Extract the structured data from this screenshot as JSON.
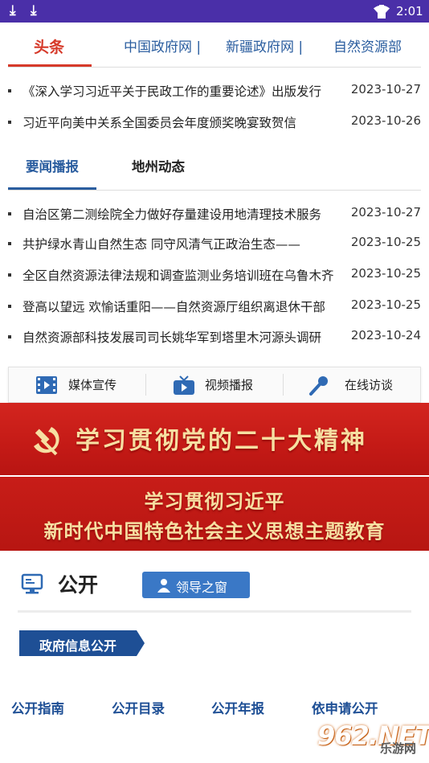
{
  "status_bar": {
    "time": "2:01",
    "download_glyph": "⤓"
  },
  "top_tabs": [
    {
      "label": "头条",
      "active": true
    },
    {
      "label": "中国政府网 |",
      "active": false
    },
    {
      "label": "新疆政府网 |",
      "active": false
    },
    {
      "label": "自然资源部",
      "active": false
    }
  ],
  "headlines": [
    {
      "title": "《深入学习习近平关于民政工作的重要论述》出版发行",
      "date": "2023-10-27"
    },
    {
      "title": "习近平向美中关系全国委员会年度颁奖晚宴致贺信",
      "date": "2023-10-26"
    }
  ],
  "sub_tabs": [
    {
      "label": "要闻播报",
      "active": true
    },
    {
      "label": "地州动态",
      "active": false
    }
  ],
  "news": [
    {
      "title": "自治区第二测绘院全力做好存量建设用地清理技术服务",
      "date": "2023-10-27"
    },
    {
      "title": "共护绿水青山自然生态 同守风清气正政治生态——",
      "date": "2023-10-25"
    },
    {
      "title": "全区自然资源法律法规和调查监测业务培训班在乌鲁木齐",
      "date": "2023-10-25"
    },
    {
      "title": "登高以望远 欢愉话重阳——自然资源厅组织离退休干部",
      "date": "2023-10-25"
    },
    {
      "title": "自然资源部科技发展司司长姚华军到塔里木河源头调研",
      "date": "2023-10-24"
    }
  ],
  "media_bar": [
    {
      "label": "媒体宣传",
      "icon": "film-icon"
    },
    {
      "label": "视频播报",
      "icon": "tv-icon"
    },
    {
      "label": "在线访谈",
      "icon": "microphone-icon"
    }
  ],
  "banners": {
    "banner1": "学习贯彻党的二十大精神",
    "banner2_line1": "学习贯彻习近平",
    "banner2_line2": "新时代中国特色社会主义思想主题教育"
  },
  "open_section": {
    "title": "公开",
    "leader_button": "领导之窗",
    "gov_info_label": "政府信息公开"
  },
  "bottom_links": [
    "公开指南",
    "公开目录",
    "公开年报",
    "依申请公开"
  ],
  "watermark": {
    "number": "962.NET",
    "site": "乐游网"
  },
  "colors": {
    "status_bar": "#4a2fa8",
    "active_red": "#d63a2a",
    "link_blue": "#2a5d9f",
    "banner_red": "#c41a16",
    "banner_gold": "#f6dfa2",
    "button_blue": "#3a78c6",
    "label_navy": "#1e4f95"
  }
}
